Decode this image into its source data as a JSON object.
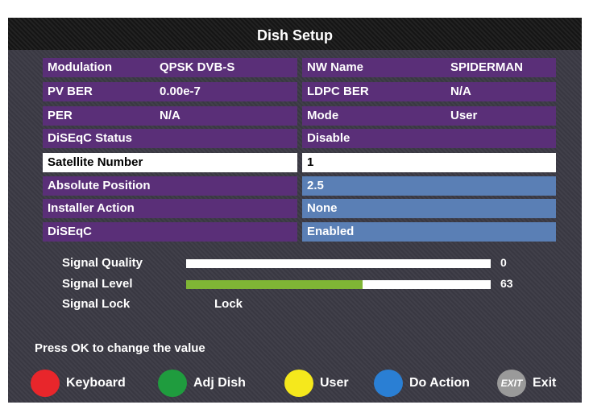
{
  "title": "Dish Setup",
  "rows": {
    "modulation": {
      "label": "Modulation",
      "value": "QPSK DVB-S"
    },
    "pv_ber": {
      "label": "PV BER",
      "value": "0.00e-7"
    },
    "per": {
      "label": "PER",
      "value": "N/A"
    },
    "nw_name": {
      "label": "NW Name",
      "value": "SPIDERMAN"
    },
    "ldpc_ber": {
      "label": "LDPC BER",
      "value": "N/A"
    },
    "mode": {
      "label": "Mode",
      "value": "User"
    },
    "diseqc_status": {
      "label": "DiSEqC Status",
      "value": "Disable"
    },
    "satellite_number": {
      "label": "Satellite Number",
      "value": "1"
    },
    "absolute_position": {
      "label": "Absolute Position",
      "value": "2.5"
    },
    "installer_action": {
      "label": "Installer Action",
      "value": "None"
    },
    "diseqc": {
      "label": "DiSEqC",
      "value": "Enabled"
    }
  },
  "signal": {
    "quality": {
      "label": "Signal Quality",
      "value": "0",
      "fraction": 0.0
    },
    "level": {
      "label": "Signal Level",
      "value": "63",
      "fraction": 0.58
    },
    "lock": {
      "label": "Signal Lock",
      "value": "Lock"
    }
  },
  "hint": "Press OK to change the value",
  "footer": {
    "keyboard": {
      "label": "Keyboard",
      "color": "#e8262b"
    },
    "adj_dish": {
      "label": "Adj Dish",
      "color": "#1f9c3e"
    },
    "user": {
      "label": "User",
      "color": "#f5e81c"
    },
    "do_action": {
      "label": "Do Action",
      "color": "#2a7fd4"
    },
    "exit": {
      "label": "Exit",
      "icon_text": "EXIT",
      "color": "#9a9a9a"
    }
  },
  "colors": {
    "row_purple": "#5a2f78",
    "row_selected": "#ffffff",
    "row_blue": "#5a7fb5",
    "level_bar": "#7fb535"
  }
}
